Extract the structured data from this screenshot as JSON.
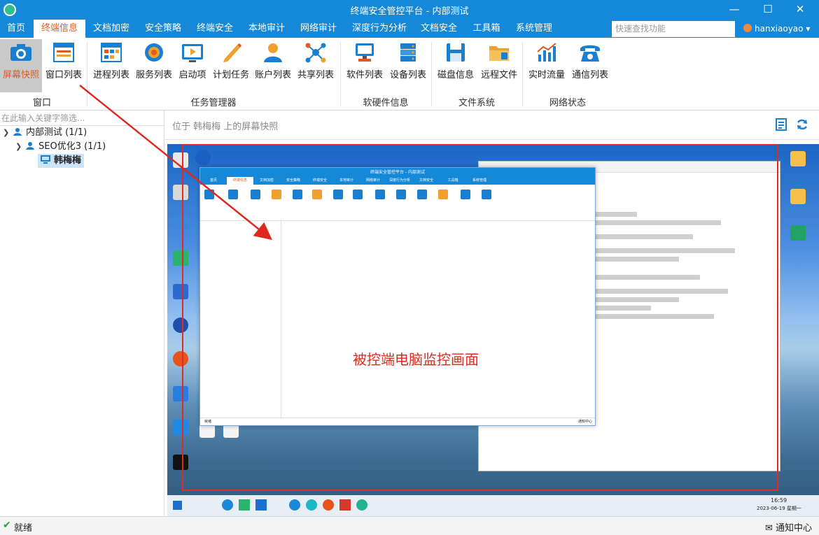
{
  "window": {
    "title": "终端安全管控平台 - 内部测试",
    "minimize": "—",
    "maximize": "☐",
    "close": "✕"
  },
  "menu": {
    "items": [
      "首页",
      "终端信息",
      "文档加密",
      "安全策略",
      "终端安全",
      "本地审计",
      "网络审计",
      "深度行为分析",
      "文档安全",
      "工具箱",
      "系统管理"
    ],
    "active_index": 1,
    "search_placeholder": "快速查找功能",
    "user": "hanxiaoyao",
    "user_menu": "▾"
  },
  "ribbon": {
    "buttons": [
      {
        "label": "屏幕快照",
        "icon": "camera-icon"
      },
      {
        "label": "窗口列表",
        "icon": "window-list-icon"
      },
      {
        "label": "进程列表",
        "icon": "process-list-icon"
      },
      {
        "label": "服务列表",
        "icon": "service-list-icon"
      },
      {
        "label": "启动项",
        "icon": "startup-icon"
      },
      {
        "label": "计划任务",
        "icon": "scheduled-task-icon"
      },
      {
        "label": "账户列表",
        "icon": "account-list-icon"
      },
      {
        "label": "共享列表",
        "icon": "share-list-icon"
      },
      {
        "label": "软件列表",
        "icon": "software-list-icon"
      },
      {
        "label": "设备列表",
        "icon": "device-list-icon"
      },
      {
        "label": "磁盘信息",
        "icon": "disk-info-icon"
      },
      {
        "label": "远程文件",
        "icon": "remote-file-icon"
      },
      {
        "label": "实时流量",
        "icon": "traffic-icon"
      },
      {
        "label": "通信列表",
        "icon": "telephone-icon"
      }
    ],
    "groups": [
      "窗口",
      "任务管理器",
      "软硬件信息",
      "文件系统",
      "网络状态"
    ]
  },
  "tree": {
    "filter_placeholder": "在此输入关键字筛选...",
    "root": "内部测试 (1/1)",
    "group": "SEO优化3 (1/1)",
    "computer": "韩梅梅"
  },
  "main": {
    "location": "位于 韩梅梅 上的屏幕快照",
    "annotation": "被控端电脑监控画面"
  },
  "snapshot": {
    "mini_title": "终端安全管控平台 - 内部测试",
    "mini_menu": [
      "首页",
      "终端信息",
      "文档加密",
      "安全策略",
      "终端安全",
      "本地审计",
      "网络审计",
      "深度行为分析",
      "文档安全",
      "工具箱",
      "系统管理"
    ],
    "mini_status": "就绪",
    "mini_notify": "通知中心",
    "clock_time": "16:59",
    "clock_date": "2023-06-19 星期一"
  },
  "status": {
    "ready": "就绪",
    "notify": "通知中心"
  },
  "colors": {
    "titlebar": "#1688d8",
    "active_tab_text": "#e05a1e",
    "annotation_red": "#e0281e"
  }
}
